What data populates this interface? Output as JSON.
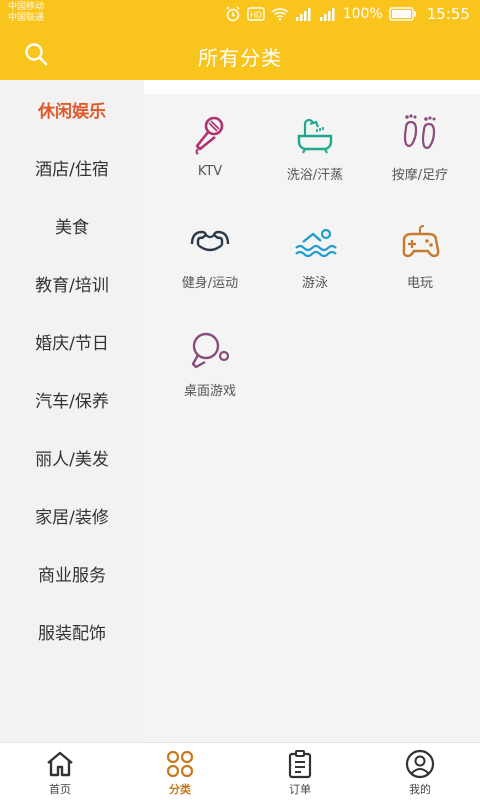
{
  "status": {
    "carrier1": "中国移动",
    "carrier2": "中国联通",
    "battery": "100%",
    "time": "15:55"
  },
  "header": {
    "title": "所有分类",
    "search_icon": "search-icon"
  },
  "sidebar": {
    "items": [
      {
        "label": "休闲娱乐",
        "active": true
      },
      {
        "label": "酒店/住宿"
      },
      {
        "label": "美食"
      },
      {
        "label": "教育/培训"
      },
      {
        "label": "婚庆/节日"
      },
      {
        "label": "汽车/保养"
      },
      {
        "label": "丽人/美发"
      },
      {
        "label": "家居/装修"
      },
      {
        "label": "商业服务"
      },
      {
        "label": "服装配饰"
      }
    ]
  },
  "categories": [
    {
      "label": "KTV",
      "icon": "microphone-icon"
    },
    {
      "label": "洗浴/汗蒸",
      "icon": "bathtub-icon"
    },
    {
      "label": "按摩/足疗",
      "icon": "footprints-icon"
    },
    {
      "label": "健身/运动",
      "icon": "fitness-icon"
    },
    {
      "label": "游泳",
      "icon": "swimming-icon"
    },
    {
      "label": "电玩",
      "icon": "gamepad-icon"
    },
    {
      "label": "桌面游戏",
      "icon": "table-tennis-icon"
    }
  ],
  "bottom_nav": [
    {
      "label": "首页",
      "icon": "home-icon"
    },
    {
      "label": "分类",
      "icon": "category-icon",
      "active": true
    },
    {
      "label": "订单",
      "icon": "clipboard-icon"
    },
    {
      "label": "我的",
      "icon": "user-icon"
    }
  ],
  "colors": {
    "brand": "#F9C51C",
    "active_text": "#E0592A",
    "nav_active": "#C77A1F"
  }
}
